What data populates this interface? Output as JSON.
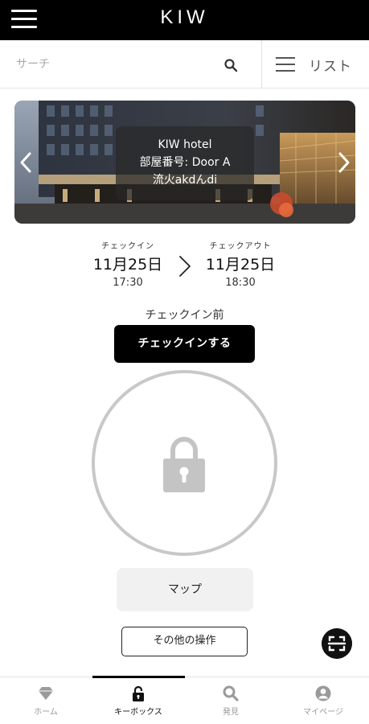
{
  "app": {
    "logo": "KIW"
  },
  "search": {
    "placeholder": "サーチ",
    "list_label": "リスト"
  },
  "banner": {
    "hotel_name": "KIW hotel",
    "room_line": "部屋番号: Door A",
    "guest_line": "流火akdんdi"
  },
  "stay": {
    "checkin_label": "チェックイン",
    "checkin_date": "11月25日",
    "checkin_time": "17:30",
    "checkout_label": "チェックアウト",
    "checkout_date": "11月25日",
    "checkout_time": "18:30"
  },
  "status": {
    "text": "チェックイン前",
    "action_label": "チェックインする"
  },
  "actions": {
    "map_label": "マップ",
    "other_label": "その他の操作"
  },
  "tabs": [
    {
      "label": "ホーム",
      "icon": "diamond-icon",
      "active": false
    },
    {
      "label": "キーボックス",
      "icon": "lock-icon",
      "active": true
    },
    {
      "label": "発見",
      "icon": "search-icon",
      "active": false
    },
    {
      "label": "マイページ",
      "icon": "user-icon",
      "active": false
    }
  ],
  "colors": {
    "primary": "#000000",
    "lock": "#c8c8c8",
    "tab_inactive": "#9a9a9a"
  }
}
